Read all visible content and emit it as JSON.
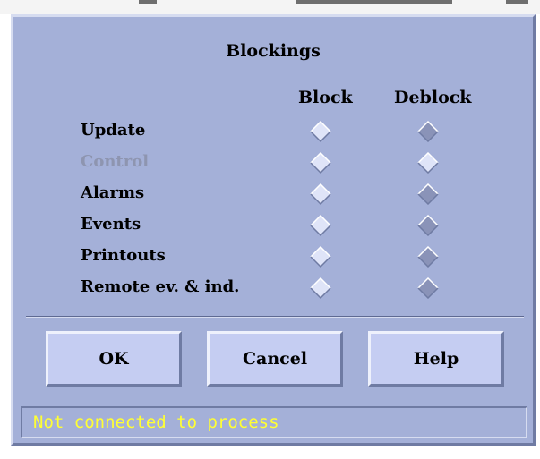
{
  "dialog": {
    "title": "Blockings",
    "columns": {
      "block": "Block",
      "deblock": "Deblock"
    },
    "rows": [
      {
        "label": "Update",
        "enabled": true,
        "block_selected": false,
        "deblock_selected": true
      },
      {
        "label": "Control",
        "enabled": false,
        "block_selected": false,
        "deblock_selected": false
      },
      {
        "label": "Alarms",
        "enabled": true,
        "block_selected": false,
        "deblock_selected": true
      },
      {
        "label": "Events",
        "enabled": true,
        "block_selected": false,
        "deblock_selected": true
      },
      {
        "label": "Printouts",
        "enabled": true,
        "block_selected": false,
        "deblock_selected": true
      },
      {
        "label": "Remote ev. & ind.",
        "enabled": true,
        "block_selected": false,
        "deblock_selected": true
      }
    ],
    "buttons": {
      "ok": "OK",
      "cancel": "Cancel",
      "help": "Help"
    },
    "status": "Not connected to process"
  },
  "colors": {
    "dialog_bg": "#a4b0d8",
    "button_bg": "#c5cdf2",
    "status_text": "#ffff33",
    "radio_unselected": "#dfe4f8",
    "radio_selected": "#8a93b8"
  }
}
